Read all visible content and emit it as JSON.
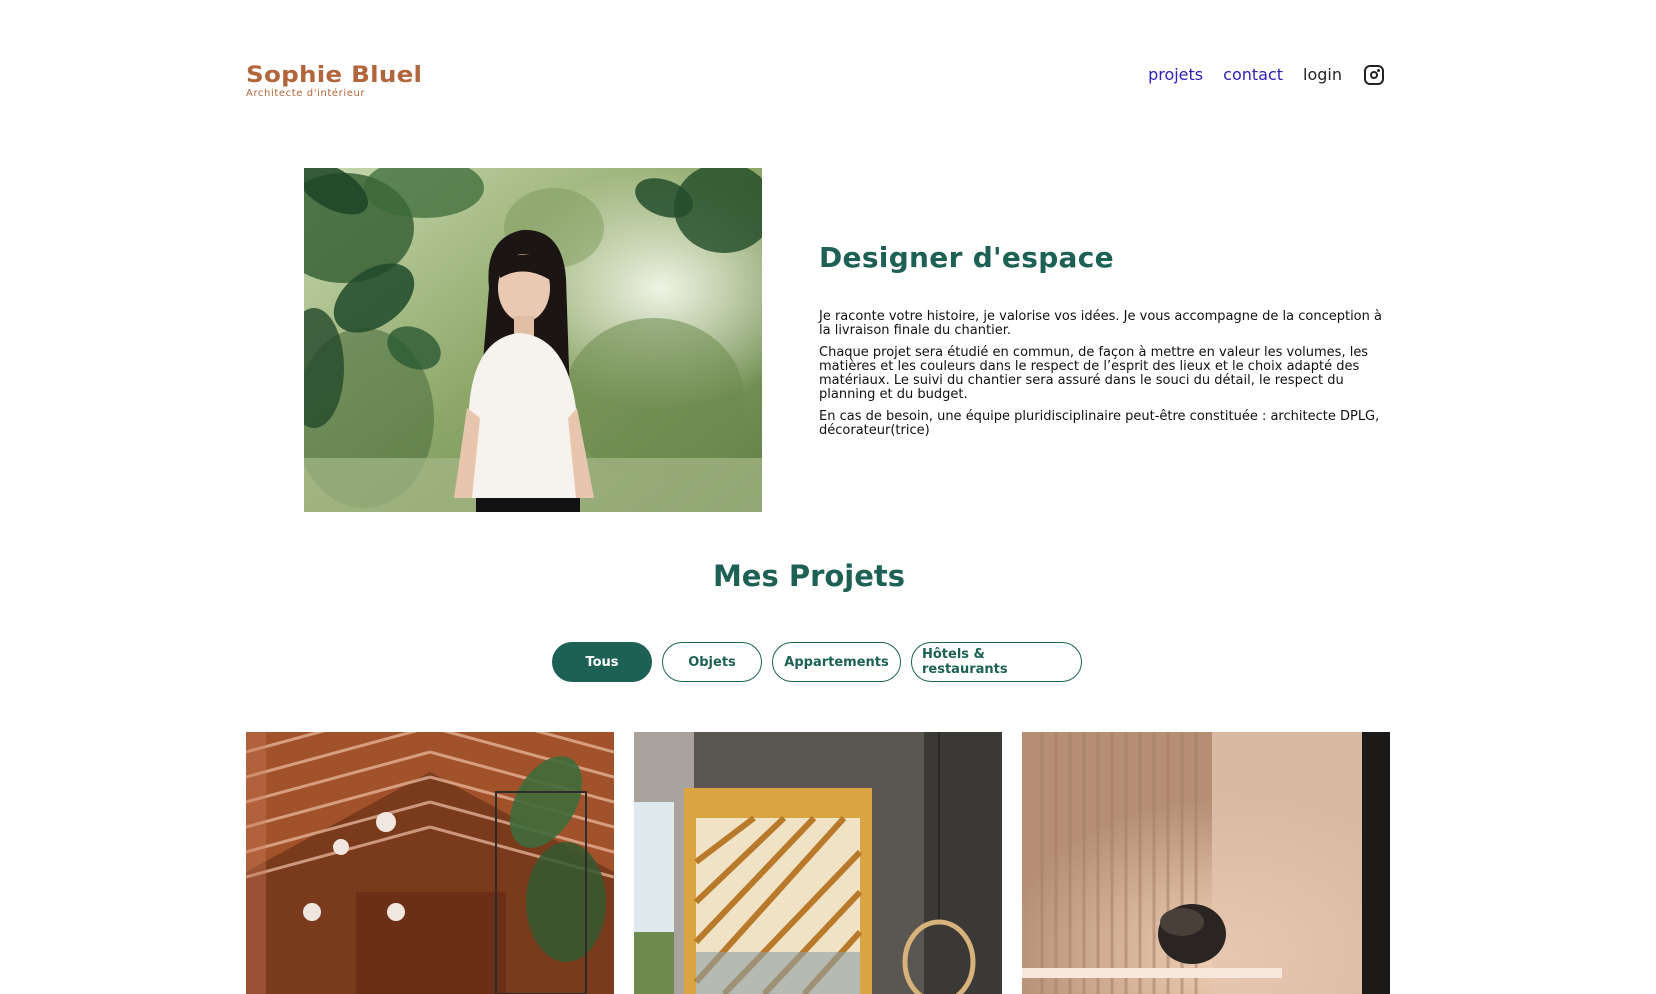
{
  "header": {
    "logo_title": "Sophie Bluel",
    "logo_subtitle": "Architecte d'intérieur",
    "nav": [
      {
        "label": "projets"
      },
      {
        "label": "contact"
      },
      {
        "label": "login"
      }
    ],
    "instagram_icon": "instagram-icon"
  },
  "intro": {
    "title": "Designer d'espace",
    "paragraphs": [
      "Je raconte votre histoire, je valorise vos idées. Je vous accompagne de la conception à la livraison finale du chantier.",
      "Chaque projet sera étudié en commun, de façon à mettre en valeur les volumes, les matières et les couleurs dans le respect de l’esprit des lieux et le choix adapté des matériaux. Le suivi du chantier sera assuré dans le souci du détail, le respect du planning et du budget.",
      "En cas de besoin, une équipe pluridisciplinaire peut-être constituée : architecte DPLG, décorateur(trice)"
    ]
  },
  "projects": {
    "title": "Mes Projets",
    "filters": [
      {
        "label": "Tous",
        "active": true
      },
      {
        "label": "Objets",
        "active": false
      },
      {
        "label": "Appartements",
        "active": false
      },
      {
        "label": "Hôtels & restaurants",
        "active": false
      }
    ]
  },
  "colors": {
    "brand": "#B1663C",
    "accent": "#1D6154",
    "nav_link": "#2E22B8"
  }
}
